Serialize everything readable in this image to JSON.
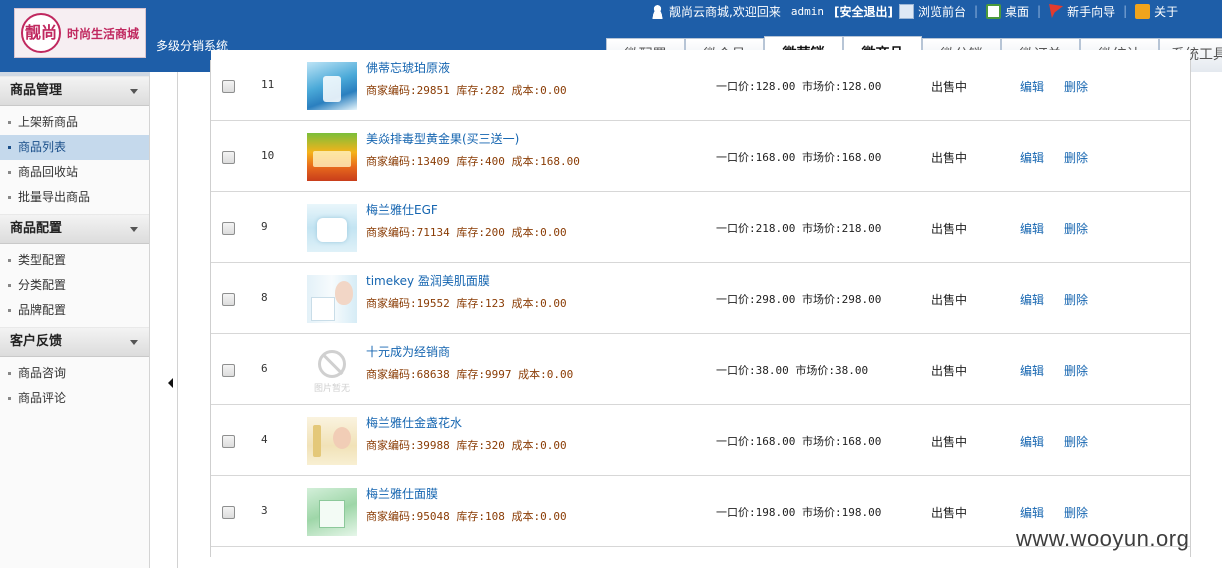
{
  "header": {
    "logo_mark": "靓尚",
    "logo_text": "时尚生活商城",
    "system_name": "多级分销系统",
    "welcome": "靓尚云商城,欢迎回来",
    "admin": "admin",
    "logout": "[安全退出]",
    "browse_front": "浏览前台",
    "desktop": "桌面",
    "guide": "新手向导",
    "about": "关于",
    "separator": "|",
    "tabs": [
      "微配置",
      "微会员",
      "微营销",
      "微商品",
      "微分销",
      "微订单",
      "微统计",
      "系统工具"
    ]
  },
  "sidebar": {
    "sections": [
      {
        "title": "商品管理",
        "items": [
          "上架新商品",
          "商品列表",
          "商品回收站",
          "批量导出商品"
        ]
      },
      {
        "title": "商品配置",
        "items": [
          "类型配置",
          "分类配置",
          "品牌配置"
        ]
      },
      {
        "title": "客户反馈",
        "items": [
          "商品咨询",
          "商品评论"
        ]
      }
    ]
  },
  "labels": {
    "code": "商家编码:",
    "stock": "库存:",
    "cost": "成本:",
    "price": "一口价:",
    "market": "市场价:",
    "edit": "编辑",
    "delete": "删除",
    "no_image": "图片暂无"
  },
  "products": [
    {
      "id": "11",
      "name": "佛蒂忘琥珀原液",
      "code": "29851",
      "stock": "282",
      "cost": "0.00",
      "price": "128.00",
      "market": "128.00",
      "status": "出售中",
      "thumb": "th-blue"
    },
    {
      "id": "10",
      "name": "美焱排毒型黄金果(买三送一)",
      "code": "13409",
      "stock": "400",
      "cost": "168.00",
      "price": "168.00",
      "market": "168.00",
      "status": "出售中",
      "thumb": "th-orange"
    },
    {
      "id": "9",
      "name": "梅兰雅仕EGF",
      "code": "71134",
      "stock": "200",
      "cost": "0.00",
      "price": "218.00",
      "market": "218.00",
      "status": "出售中",
      "thumb": "th-ice"
    },
    {
      "id": "8",
      "name": "timekey 盈润美肌面膜",
      "code": "19552",
      "stock": "123",
      "cost": "0.00",
      "price": "298.00",
      "market": "298.00",
      "status": "出售中",
      "thumb": "th-face"
    },
    {
      "id": "6",
      "name": "十元成为经销商",
      "code": "68638",
      "stock": "9997",
      "cost": "0.00",
      "price": "38.00",
      "market": "38.00",
      "status": "出售中",
      "thumb": "th-none"
    },
    {
      "id": "4",
      "name": "梅兰雅仕金盏花水",
      "code": "39988",
      "stock": "320",
      "cost": "0.00",
      "price": "168.00",
      "market": "168.00",
      "status": "出售中",
      "thumb": "th-cream"
    },
    {
      "id": "3",
      "name": "梅兰雅仕面膜",
      "code": "95048",
      "stock": "108",
      "cost": "0.00",
      "price": "198.00",
      "market": "198.00",
      "status": "出售中",
      "thumb": "th-green"
    }
  ],
  "watermark": "www.wooyun.org"
}
